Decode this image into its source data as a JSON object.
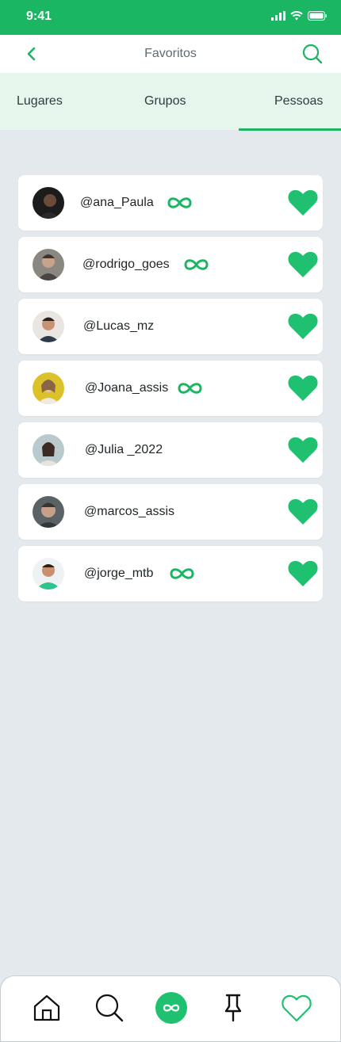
{
  "status": {
    "time": "9:41"
  },
  "header": {
    "title": "Favoritos"
  },
  "tabs": [
    {
      "label": "Lugares",
      "active": false
    },
    {
      "label": "Grupos",
      "active": false
    },
    {
      "label": "Pessoas",
      "active": true
    }
  ],
  "people": [
    {
      "username": "@ana_Paula",
      "infinity": true
    },
    {
      "username": "@rodrigo_goes",
      "infinity": true
    },
    {
      "username": "@Lucas_mz",
      "infinity": false
    },
    {
      "username": "@Joana_assis",
      "infinity": true
    },
    {
      "username": "@Julia _2022",
      "infinity": false
    },
    {
      "username": "@marcos_assis",
      "infinity": false
    },
    {
      "username": "@jorge_mtb",
      "infinity": true
    }
  ],
  "nav": {
    "items": [
      "home-icon",
      "search-icon",
      "infinity-icon",
      "pin-icon",
      "heart-icon"
    ],
    "active": "heart-icon"
  },
  "colors": {
    "accent": "#1ab663",
    "background": "#e4e9ed",
    "tab_bg": "#e6f6ed"
  }
}
